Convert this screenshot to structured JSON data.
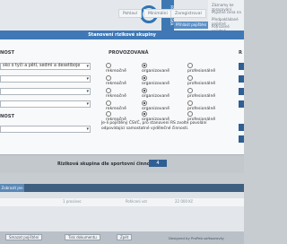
{
  "background": {
    "top_tabs": [
      "Pohlaví",
      "Minimální",
      "Zaregistroval"
    ],
    "blue_tab": "Přihlásit pojištění",
    "side_tab": "PŘIHLÁŠKA",
    "right_items": [
      "Záznamy ke zpracování",
      "Pojistné cena na",
      "Předpokládané pojistné",
      "Potrvzené pojistné"
    ],
    "lower_button": "Zobrazit jen zadání",
    "table_row": [
      "1 prosinec",
      "Pohlcení vst",
      "22 000 Kč"
    ],
    "footer_buttons": [
      "Smazat pojištění",
      "Tisk dokumentu",
      "Zpět"
    ],
    "footer_note": "Designed by ProPeb softwarovky"
  },
  "modal": {
    "title": "Stanovení rizikové skupiny",
    "left_header_1": "NOST",
    "left_header_2": "NOST",
    "middle_header": "PROVOZOVANÁ",
    "right_header": "R",
    "selects": [
      {
        "value": "sko o tyči a pětí, sedmi a desetiboje"
      },
      {
        "value": ""
      },
      {
        "value": ""
      },
      {
        "value": ""
      },
      {
        "value": ""
      }
    ],
    "radio_rows": [
      {
        "options": [
          "rekreačně",
          "organizovaně",
          "profesionálně"
        ],
        "selected": 1
      },
      {
        "options": [
          "rekreačně",
          "organizovaně",
          "profesionálně"
        ],
        "selected": 1
      },
      {
        "options": [
          "rekreačně",
          "organizovaně",
          "profesionálně"
        ],
        "selected": 1
      },
      {
        "options": [
          "rekreačně",
          "organizovaně",
          "profesionálně"
        ],
        "selected": 1
      },
      {
        "options": [
          "rekreačně",
          "organizovaně",
          "profesionálně"
        ],
        "selected": 1
      }
    ],
    "note": "Je-li pojištěný ČSVČ, pro stanovení RS zvolte povolání odpovídající samostatné výdělečné činnosti.",
    "result_label": "Riziková skupina dle sportovní činnosti:",
    "result_value": "4"
  },
  "colors": {
    "primary": "#3f78b5",
    "dark_button": "#2f5f93"
  }
}
